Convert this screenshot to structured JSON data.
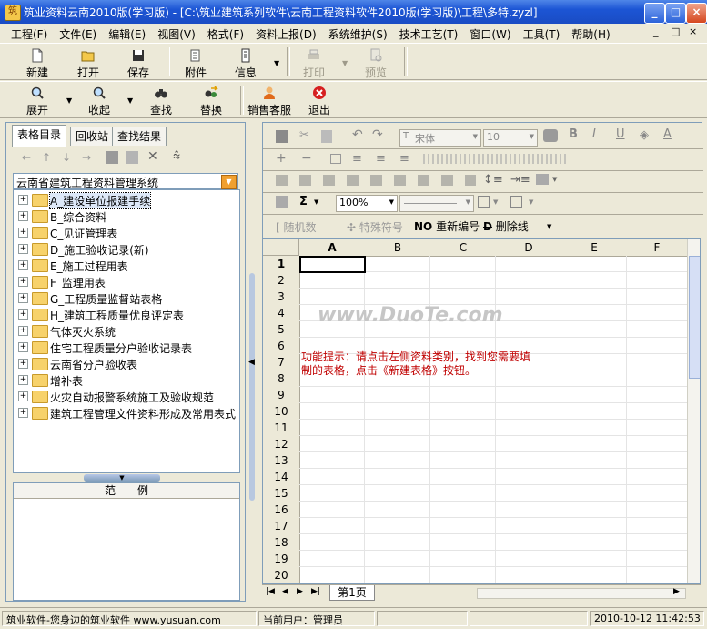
{
  "window": {
    "title": "筑业资料云南2010版(学习版) - [C:\\筑业建筑系列软件\\云南工程资料软件2010版(学习版)\\工程\\多特.zyzl]",
    "buttons": [
      "_",
      "□",
      "×"
    ]
  },
  "menubar": {
    "items": [
      "工程(F)",
      "文件(E)",
      "编辑(E)",
      "视图(V)",
      "格式(F)",
      "资料上报(D)",
      "系统维护(S)",
      "技术工艺(T)",
      "窗口(W)",
      "工具(T)",
      "帮助(H)"
    ],
    "mdi_controls": [
      "_",
      "□",
      "×"
    ]
  },
  "toolbar1": {
    "new": "新建",
    "open": "打开",
    "save": "保存",
    "attach": "附件",
    "info": "信息",
    "print": "打印",
    "preview": "预览"
  },
  "toolbar2": {
    "expand": "展开",
    "collapse": "收起",
    "find": "查找",
    "replace": "替换",
    "service": "销售客服",
    "exit": "退出"
  },
  "left_panel": {
    "tabs": [
      "表格目录",
      "回收站",
      "查找结果"
    ],
    "combo_value": "云南省建筑工程资料管理系统",
    "tree_items": [
      "A_建设单位报建手续",
      "B_综合资料",
      "C_见证管理表",
      "D_施工验收记录(新)",
      "E_施工过程用表",
      "F_监理用表",
      "G_工程质量监督站表格",
      "H_建筑工程质量优良评定表",
      "气体灭火系统",
      "住宅工程质量分户验收记录表",
      "云南省分户验收表",
      "增补表",
      "火灾自动报警系统施工及验收规范",
      "建筑工程管理文件资料形成及常用表式"
    ],
    "example_header": "范　　例"
  },
  "format_bar": {
    "font_name": "宋体",
    "font_size": "10",
    "zoom": "100%",
    "bold": "B",
    "italic": "I",
    "underline": "U",
    "sigma": "Σ",
    "random": "随机数",
    "special": "特殊符号",
    "renumber": "重新编号",
    "strike": "删除线"
  },
  "grid": {
    "columns": [
      "A",
      "B",
      "C",
      "D",
      "E",
      "F"
    ],
    "rows": [
      "1",
      "2",
      "3",
      "4",
      "5",
      "6",
      "7",
      "8",
      "9",
      "10",
      "11",
      "12",
      "13",
      "14",
      "15",
      "16",
      "17",
      "18",
      "19",
      "20"
    ],
    "hint_line1": "功能提示：请点击左侧资料类别，找到您需要填",
    "hint_line2": "制的表格，点击《新建表格》按钮。",
    "watermark": "www.DuoTe.com",
    "sheet_tab": "第1页"
  },
  "statusbar": {
    "slogan": "筑业软件-您身边的筑业软件 www.yusuan.com",
    "user": "当前用户：管理员",
    "datetime": "2010-10-12 11:42:53"
  },
  "colors": {
    "hint": "#c00000",
    "title_blue": "#1c55d4",
    "watermark": "#c6c6c6"
  }
}
